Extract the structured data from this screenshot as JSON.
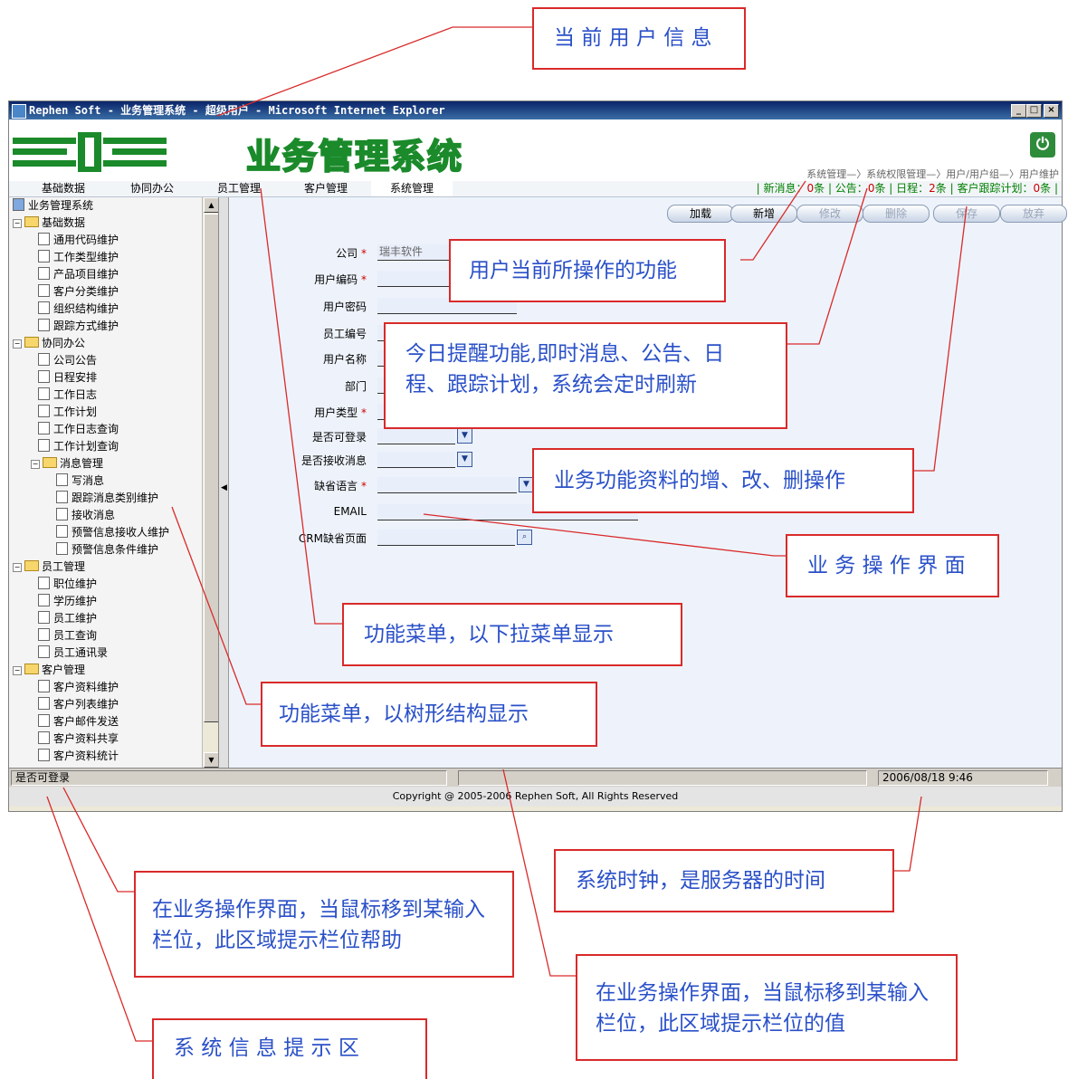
{
  "window": {
    "title": "Rephen Soft - 业务管理系统 - 超级用户 - Microsoft Internet Explorer",
    "controls": [
      "_",
      "□",
      "×"
    ]
  },
  "header": {
    "app_title": "业务管理系统",
    "nav_path": "系统管理—〉系统权限管理—〉用户/用户组—〉用户维护",
    "power_icon": "power-icon"
  },
  "menu": [
    "基础数据",
    "协同办公",
    "员工管理",
    "客户管理",
    "系统管理"
  ],
  "reminders": {
    "new_msg_label": "| 新消息：",
    "new_msg": "0",
    "new_msg_unit": "条",
    "notice_label": " | 公告：",
    "notice": "0",
    "notice_unit": "条",
    "schedule_label": " | 日程：",
    "schedule": "2",
    "schedule_unit": "条",
    "plan_label": " | 客户跟踪计划：",
    "plan": "0",
    "plan_unit": "条 |"
  },
  "tree": [
    {
      "label": "业务管理系统",
      "level": 0,
      "type": "root"
    },
    {
      "label": "基础数据",
      "level": 0,
      "type": "folder"
    },
    {
      "label": "通用代码维护",
      "level": 1,
      "type": "leaf"
    },
    {
      "label": "工作类型维护",
      "level": 1,
      "type": "leaf"
    },
    {
      "label": "产品项目维护",
      "level": 1,
      "type": "leaf"
    },
    {
      "label": "客户分类维护",
      "level": 1,
      "type": "leaf"
    },
    {
      "label": "组织结构维护",
      "level": 1,
      "type": "leaf"
    },
    {
      "label": "跟踪方式维护",
      "level": 1,
      "type": "leaf"
    },
    {
      "label": "协同办公",
      "level": 0,
      "type": "folder"
    },
    {
      "label": "公司公告",
      "level": 1,
      "type": "leaf"
    },
    {
      "label": "日程安排",
      "level": 1,
      "type": "leaf"
    },
    {
      "label": "工作日志",
      "level": 1,
      "type": "leaf"
    },
    {
      "label": "工作计划",
      "level": 1,
      "type": "leaf"
    },
    {
      "label": "工作日志查询",
      "level": 1,
      "type": "leaf"
    },
    {
      "label": "工作计划查询",
      "level": 1,
      "type": "leaf"
    },
    {
      "label": "消息管理",
      "level": 1,
      "type": "folder"
    },
    {
      "label": "写消息",
      "level": 2,
      "type": "leaf"
    },
    {
      "label": "跟踪消息类别维护",
      "level": 2,
      "type": "leaf"
    },
    {
      "label": "接收消息",
      "level": 2,
      "type": "leaf"
    },
    {
      "label": "预警信息接收人维护",
      "level": 2,
      "type": "leaf"
    },
    {
      "label": "预警信息条件维护",
      "level": 2,
      "type": "leaf"
    },
    {
      "label": "员工管理",
      "level": 0,
      "type": "folder"
    },
    {
      "label": "职位维护",
      "level": 1,
      "type": "leaf"
    },
    {
      "label": "学历维护",
      "level": 1,
      "type": "leaf"
    },
    {
      "label": "员工维护",
      "level": 1,
      "type": "leaf"
    },
    {
      "label": "员工查询",
      "level": 1,
      "type": "leaf"
    },
    {
      "label": "员工通讯录",
      "level": 1,
      "type": "leaf"
    },
    {
      "label": "客户管理",
      "level": 0,
      "type": "folder"
    },
    {
      "label": "客户资料维护",
      "level": 1,
      "type": "leaf"
    },
    {
      "label": "客户列表维护",
      "level": 1,
      "type": "leaf"
    },
    {
      "label": "客户邮件发送",
      "level": 1,
      "type": "leaf"
    },
    {
      "label": "客户资料共享",
      "level": 1,
      "type": "leaf"
    },
    {
      "label": "客户资料统计",
      "level": 1,
      "type": "leaf"
    }
  ],
  "toolbar": [
    {
      "label": "加载",
      "enabled": true
    },
    {
      "label": "新增",
      "enabled": true
    },
    {
      "label": "修改",
      "enabled": false
    },
    {
      "label": "删除",
      "enabled": false
    },
    {
      "label": "保存",
      "enabled": false
    },
    {
      "label": "放弃",
      "enabled": false
    }
  ],
  "form": [
    {
      "label": "公司",
      "required": true,
      "value": "瑞丰软件",
      "kind": "text"
    },
    {
      "label": "用户编码",
      "required": true,
      "value": "",
      "kind": "text"
    },
    {
      "label": "用户密码",
      "required": false,
      "value": "",
      "kind": "text"
    },
    {
      "label": "员工编号",
      "required": false,
      "value": "",
      "kind": "text"
    },
    {
      "label": "用户名称",
      "required": false,
      "value": "",
      "kind": "text"
    },
    {
      "label": "部门",
      "required": false,
      "value": "",
      "kind": "text"
    },
    {
      "label": "用户类型",
      "required": true,
      "value": "",
      "kind": "text"
    },
    {
      "label": "是否可登录",
      "required": false,
      "value": "",
      "kind": "select"
    },
    {
      "label": "是否接收消息",
      "required": false,
      "value": "",
      "kind": "select"
    },
    {
      "label": "缺省语言",
      "required": true,
      "value": "",
      "kind": "select"
    },
    {
      "label": "EMAIL",
      "required": false,
      "value": "",
      "kind": "text"
    },
    {
      "label": "CRM缺省页面",
      "required": false,
      "value": "",
      "kind": "lookup"
    }
  ],
  "status": {
    "help": "是否可登录",
    "value": "",
    "clock": "2006/08/18 9:46"
  },
  "footer": "Copyright @ 2005-2006 Rephen Soft, All Rights Reserved",
  "notes": {
    "current_user": "当 前 用 户 信 息",
    "current_function": "用户当前所操作的功能",
    "reminder": "今日提醒功能,即时消息、公告、日程、跟踪计划，系统会定时刷新",
    "crud": "业务功能资料的增、改、删操作",
    "work_area": "业 务 操 作 界 面",
    "dropdown_menu": "功能菜单，以下拉菜单显示",
    "tree_menu": "功能菜单，以树形结构显示",
    "field_help": "在业务操作界面，当鼠标移到某输入栏位，此区域提示栏位帮助",
    "clock": "系统时钟，是服务器的时间",
    "field_value": "在业务操作界面，当鼠标移到某输入栏位，此区域提示栏位的值",
    "sys_info": "系 统 信 息 提 示 区"
  },
  "colors": {
    "annotation_border": "#d92a2a",
    "annotation_text": "#2a50c8",
    "brand_green": "#1a8a2a"
  }
}
